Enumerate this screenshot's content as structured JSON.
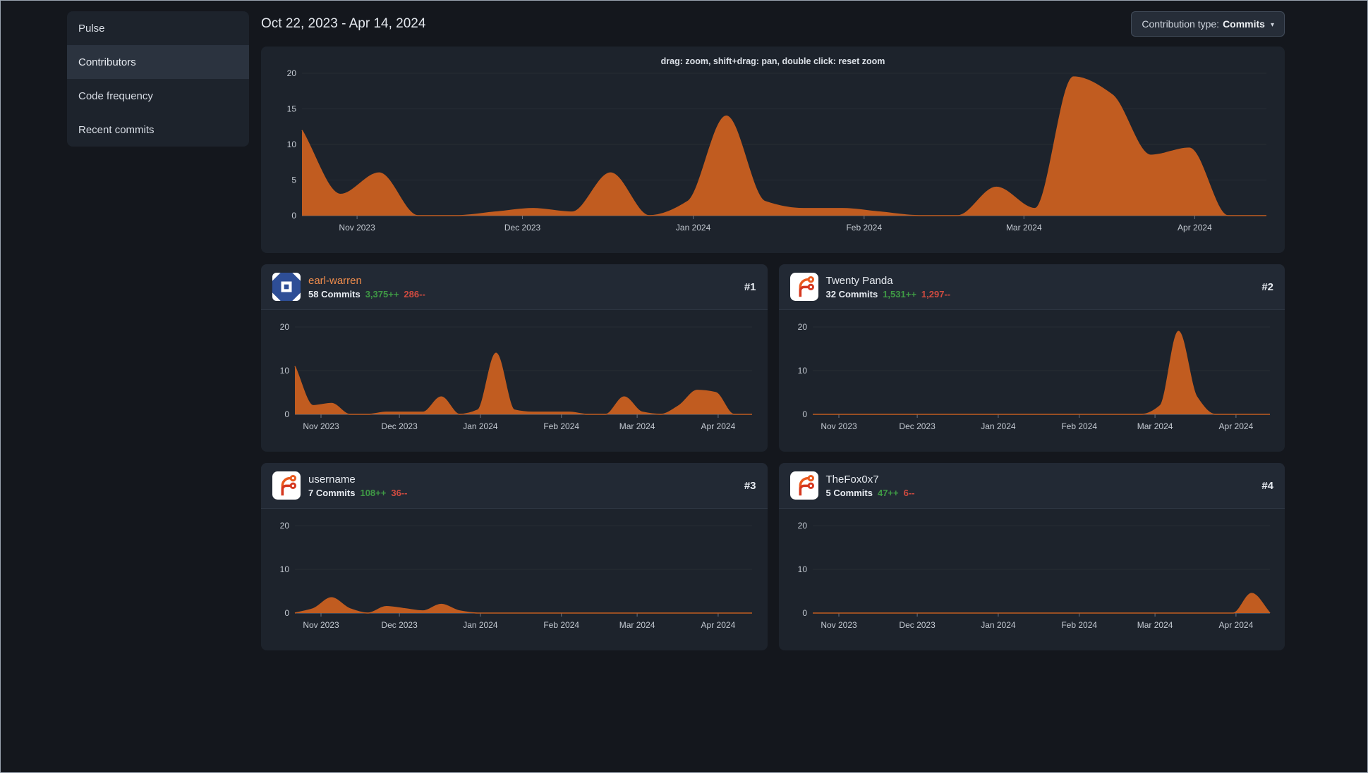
{
  "sidebar": {
    "items": [
      {
        "label": "Pulse",
        "active": false
      },
      {
        "label": "Contributors",
        "active": true
      },
      {
        "label": "Code frequency",
        "active": false
      },
      {
        "label": "Recent commits",
        "active": false
      }
    ]
  },
  "header": {
    "date_range": "Oct 22, 2023 - Apr 14, 2024",
    "contribution_type_label": "Contribution type:",
    "contribution_type_value": "Commits",
    "caret": "▾"
  },
  "main_chart": {
    "hint": "drag: zoom, shift+drag: pan, double click: reset zoom"
  },
  "contributors": [
    {
      "name": "earl-warren",
      "rank": "#1",
      "commits": "58 Commits",
      "additions": "3,375++",
      "deletions": "286--",
      "avatar": "blue-identicon",
      "linked": true
    },
    {
      "name": "Twenty Panda",
      "rank": "#2",
      "commits": "32 Commits",
      "additions": "1,531++",
      "deletions": "1,297--",
      "avatar": "forgejo-logo",
      "linked": false
    },
    {
      "name": "username",
      "rank": "#3",
      "commits": "7 Commits",
      "additions": "108++",
      "deletions": "36--",
      "avatar": "forgejo-logo",
      "linked": false
    },
    {
      "name": "TheFox0x7",
      "rank": "#4",
      "commits": "5 Commits",
      "additions": "47++",
      "deletions": "6--",
      "avatar": "forgejo-logo",
      "linked": false
    }
  ],
  "colors": {
    "area": "#c15c20",
    "link": "#ef8c4c",
    "additions_green": "#3f9a45",
    "deletions_red": "#d04b40"
  },
  "chart_data": [
    {
      "type": "area",
      "name": "all-contributors-commits",
      "x_start": "Oct 22, 2023",
      "x_end": "Apr 14, 2024",
      "ylim": [
        0,
        20
      ],
      "yticks": [
        0,
        5,
        10,
        15,
        20
      ],
      "grid": true,
      "months": [
        {
          "label": "Nov 2023",
          "pos": 0.0571
        },
        {
          "label": "Dec 2023",
          "pos": 0.2286
        },
        {
          "label": "Jan 2024",
          "pos": 0.4057
        },
        {
          "label": "Feb 2024",
          "pos": 0.5829
        },
        {
          "label": "Mar 2024",
          "pos": 0.7486
        },
        {
          "label": "Apr 2024",
          "pos": 0.9257
        }
      ],
      "values": [
        12,
        3,
        6,
        0,
        0,
        0.5,
        1,
        0.5,
        6,
        0,
        2,
        14,
        2,
        1,
        1,
        0.5,
        0,
        0,
        4,
        1,
        19.5,
        17,
        8.5,
        9.5,
        0,
        0
      ]
    },
    {
      "type": "area",
      "name": "earl-warren-commits",
      "ylim": [
        0,
        20
      ],
      "yticks": [
        0,
        10,
        20
      ],
      "grid": true,
      "months": [
        {
          "label": "Nov 2023",
          "pos": 0.0571
        },
        {
          "label": "Dec 2023",
          "pos": 0.2286
        },
        {
          "label": "Jan 2024",
          "pos": 0.4057
        },
        {
          "label": "Feb 2024",
          "pos": 0.5829
        },
        {
          "label": "Mar 2024",
          "pos": 0.7486
        },
        {
          "label": "Apr 2024",
          "pos": 0.9257
        }
      ],
      "values": [
        11,
        2,
        2.5,
        0,
        0,
        0.5,
        0.5,
        0.5,
        4,
        0,
        1,
        14,
        1,
        0.5,
        0.5,
        0.5,
        0,
        0,
        4,
        0.5,
        0,
        2,
        5.5,
        5,
        0,
        0
      ]
    },
    {
      "type": "area",
      "name": "twenty-panda-commits",
      "ylim": [
        0,
        20
      ],
      "yticks": [
        0,
        10,
        20
      ],
      "grid": true,
      "months": [
        {
          "label": "Nov 2023",
          "pos": 0.0571
        },
        {
          "label": "Dec 2023",
          "pos": 0.2286
        },
        {
          "label": "Jan 2024",
          "pos": 0.4057
        },
        {
          "label": "Feb 2024",
          "pos": 0.5829
        },
        {
          "label": "Mar 2024",
          "pos": 0.7486
        },
        {
          "label": "Apr 2024",
          "pos": 0.9257
        }
      ],
      "values": [
        0,
        0,
        0,
        0,
        0,
        0,
        0,
        0,
        0,
        0,
        0,
        0,
        0,
        0,
        0,
        0,
        0,
        0,
        0,
        2,
        19,
        4,
        0,
        0,
        0,
        0
      ]
    },
    {
      "type": "area",
      "name": "username-commits",
      "ylim": [
        0,
        20
      ],
      "yticks": [
        0,
        10,
        20
      ],
      "grid": true,
      "months": [
        {
          "label": "Nov 2023",
          "pos": 0.0571
        },
        {
          "label": "Dec 2023",
          "pos": 0.2286
        },
        {
          "label": "Jan 2024",
          "pos": 0.4057
        },
        {
          "label": "Feb 2024",
          "pos": 0.5829
        },
        {
          "label": "Mar 2024",
          "pos": 0.7486
        },
        {
          "label": "Apr 2024",
          "pos": 0.9257
        }
      ],
      "values": [
        0,
        1,
        3.5,
        1,
        0,
        1.5,
        1,
        0.5,
        2,
        0.5,
        0,
        0,
        0,
        0,
        0,
        0,
        0,
        0,
        0,
        0,
        0,
        0,
        0,
        0,
        0,
        0
      ]
    },
    {
      "type": "area",
      "name": "thefox0x7-commits",
      "ylim": [
        0,
        20
      ],
      "yticks": [
        0,
        10,
        20
      ],
      "grid": true,
      "months": [
        {
          "label": "Nov 2023",
          "pos": 0.0571
        },
        {
          "label": "Dec 2023",
          "pos": 0.2286
        },
        {
          "label": "Jan 2024",
          "pos": 0.4057
        },
        {
          "label": "Feb 2024",
          "pos": 0.5829
        },
        {
          "label": "Mar 2024",
          "pos": 0.7486
        },
        {
          "label": "Apr 2024",
          "pos": 0.9257
        }
      ],
      "values": [
        0,
        0,
        0,
        0,
        0,
        0,
        0,
        0,
        0,
        0,
        0,
        0,
        0,
        0,
        0,
        0,
        0,
        0,
        0,
        0,
        0,
        0,
        0,
        0,
        4.5,
        0
      ]
    }
  ]
}
